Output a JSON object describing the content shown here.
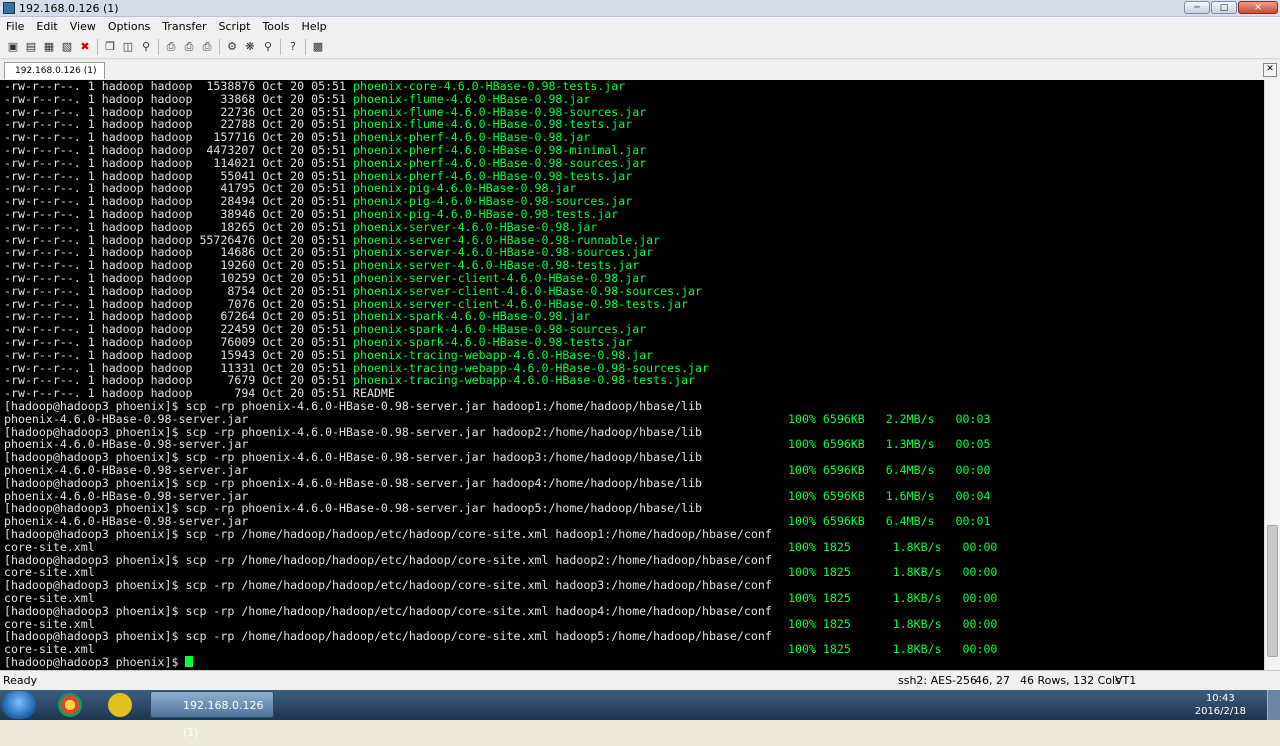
{
  "window": {
    "title": "192.168.0.126 (1)"
  },
  "menu": [
    "File",
    "Edit",
    "View",
    "Options",
    "Transfer",
    "Script",
    "Tools",
    "Help"
  ],
  "tab": {
    "label": "192.168.0.126 (1)"
  },
  "listing": [
    {
      "size": "1538876",
      "name": "phoenix-core-4.6.0-HBase-0.98-tests.jar"
    },
    {
      "size": "33868",
      "name": "phoenix-flume-4.6.0-HBase-0.98.jar"
    },
    {
      "size": "22736",
      "name": "phoenix-flume-4.6.0-HBase-0.98-sources.jar"
    },
    {
      "size": "22788",
      "name": "phoenix-flume-4.6.0-HBase-0.98-tests.jar"
    },
    {
      "size": "157716",
      "name": "phoenix-pherf-4.6.0-HBase-0.98.jar"
    },
    {
      "size": "4473207",
      "name": "phoenix-pherf-4.6.0-HBase-0.98-minimal.jar"
    },
    {
      "size": "114021",
      "name": "phoenix-pherf-4.6.0-HBase-0.98-sources.jar"
    },
    {
      "size": "55041",
      "name": "phoenix-pherf-4.6.0-HBase-0.98-tests.jar"
    },
    {
      "size": "41795",
      "name": "phoenix-pig-4.6.0-HBase-0.98.jar"
    },
    {
      "size": "28494",
      "name": "phoenix-pig-4.6.0-HBase-0.98-sources.jar"
    },
    {
      "size": "38946",
      "name": "phoenix-pig-4.6.0-HBase-0.98-tests.jar"
    },
    {
      "size": "18265",
      "name": "phoenix-server-4.6.0-HBase-0.98.jar"
    },
    {
      "size": "55726476",
      "name": "phoenix-server-4.6.0-HBase-0.98-runnable.jar"
    },
    {
      "size": "14686",
      "name": "phoenix-server-4.6.0-HBase-0.98-sources.jar"
    },
    {
      "size": "19260",
      "name": "phoenix-server-4.6.0-HBase-0.98-tests.jar"
    },
    {
      "size": "10259",
      "name": "phoenix-server-client-4.6.0-HBase-0.98.jar"
    },
    {
      "size": "8754",
      "name": "phoenix-server-client-4.6.0-HBase-0.98-sources.jar"
    },
    {
      "size": "7076",
      "name": "phoenix-server-client-4.6.0-HBase-0.98-tests.jar"
    },
    {
      "size": "67264",
      "name": "phoenix-spark-4.6.0-HBase-0.98.jar"
    },
    {
      "size": "22459",
      "name": "phoenix-spark-4.6.0-HBase-0.98-sources.jar"
    },
    {
      "size": "76009",
      "name": "phoenix-spark-4.6.0-HBase-0.98-tests.jar"
    },
    {
      "size": "15943",
      "name": "phoenix-tracing-webapp-4.6.0-HBase-0.98.jar"
    },
    {
      "size": "11331",
      "name": "phoenix-tracing-webapp-4.6.0-HBase-0.98-sources.jar"
    },
    {
      "size": "7679",
      "name": "phoenix-tracing-webapp-4.6.0-HBase-0.98-tests.jar"
    },
    {
      "size": "794",
      "name": "README"
    }
  ],
  "listing_prefix": "-rw-r--r--. 1 hadoop hadoop",
  "listing_date": "Oct 20 05:51",
  "prompt": "[hadoop@hadoop3 phoenix]$ ",
  "transfers": [
    {
      "cmd": "scp -rp phoenix-4.6.0-HBase-0.98-server.jar hadoop1:/home/hadoop/hbase/lib",
      "file": "phoenix-4.6.0-HBase-0.98-server.jar",
      "progress": "100% 6596KB   2.2MB/s   00:03"
    },
    {
      "cmd": "scp -rp phoenix-4.6.0-HBase-0.98-server.jar hadoop2:/home/hadoop/hbase/lib",
      "file": "phoenix-4.6.0-HBase-0.98-server.jar",
      "progress": "100% 6596KB   1.3MB/s   00:05"
    },
    {
      "cmd": "scp -rp phoenix-4.6.0-HBase-0.98-server.jar hadoop3:/home/hadoop/hbase/lib",
      "file": "phoenix-4.6.0-HBase-0.98-server.jar",
      "progress": "100% 6596KB   6.4MB/s   00:00"
    },
    {
      "cmd": "scp -rp phoenix-4.6.0-HBase-0.98-server.jar hadoop4:/home/hadoop/hbase/lib",
      "file": "phoenix-4.6.0-HBase-0.98-server.jar",
      "progress": "100% 6596KB   1.6MB/s   00:04"
    },
    {
      "cmd": "scp -rp phoenix-4.6.0-HBase-0.98-server.jar hadoop5:/home/hadoop/hbase/lib",
      "file": "phoenix-4.6.0-HBase-0.98-server.jar",
      "progress": "100% 6596KB   6.4MB/s   00:01"
    },
    {
      "cmd": "scp -rp /home/hadoop/hadoop/etc/hadoop/core-site.xml hadoop1:/home/hadoop/hbase/conf",
      "file": "core-site.xml",
      "progress": "100% 1825      1.8KB/s   00:00"
    },
    {
      "cmd": "scp -rp /home/hadoop/hadoop/etc/hadoop/core-site.xml hadoop2:/home/hadoop/hbase/conf",
      "file": "core-site.xml",
      "progress": "100% 1825      1.8KB/s   00:00"
    },
    {
      "cmd": "scp -rp /home/hadoop/hadoop/etc/hadoop/core-site.xml hadoop3:/home/hadoop/hbase/conf",
      "file": "core-site.xml",
      "progress": "100% 1825      1.8KB/s   00:00"
    },
    {
      "cmd": "scp -rp /home/hadoop/hadoop/etc/hadoop/core-site.xml hadoop4:/home/hadoop/hbase/conf",
      "file": "core-site.xml",
      "progress": "100% 1825      1.8KB/s   00:00"
    },
    {
      "cmd": "scp -rp /home/hadoop/hadoop/etc/hadoop/core-site.xml hadoop5:/home/hadoop/hbase/conf",
      "file": "core-site.xml",
      "progress": "100% 1825      1.8KB/s   00:00"
    }
  ],
  "status": {
    "ready": "Ready",
    "cipher": "ssh2: AES-256",
    "cursor_pos": "46,  27",
    "size": "46 Rows, 132 Cols",
    "term": "VT1"
  },
  "taskbar": {
    "item_label": "192.168.0.126 (1)",
    "time": "10:43",
    "date": "2016/2/18"
  },
  "colors": {
    "terminal_bg": "#000000",
    "terminal_fg": "#00ff40"
  }
}
